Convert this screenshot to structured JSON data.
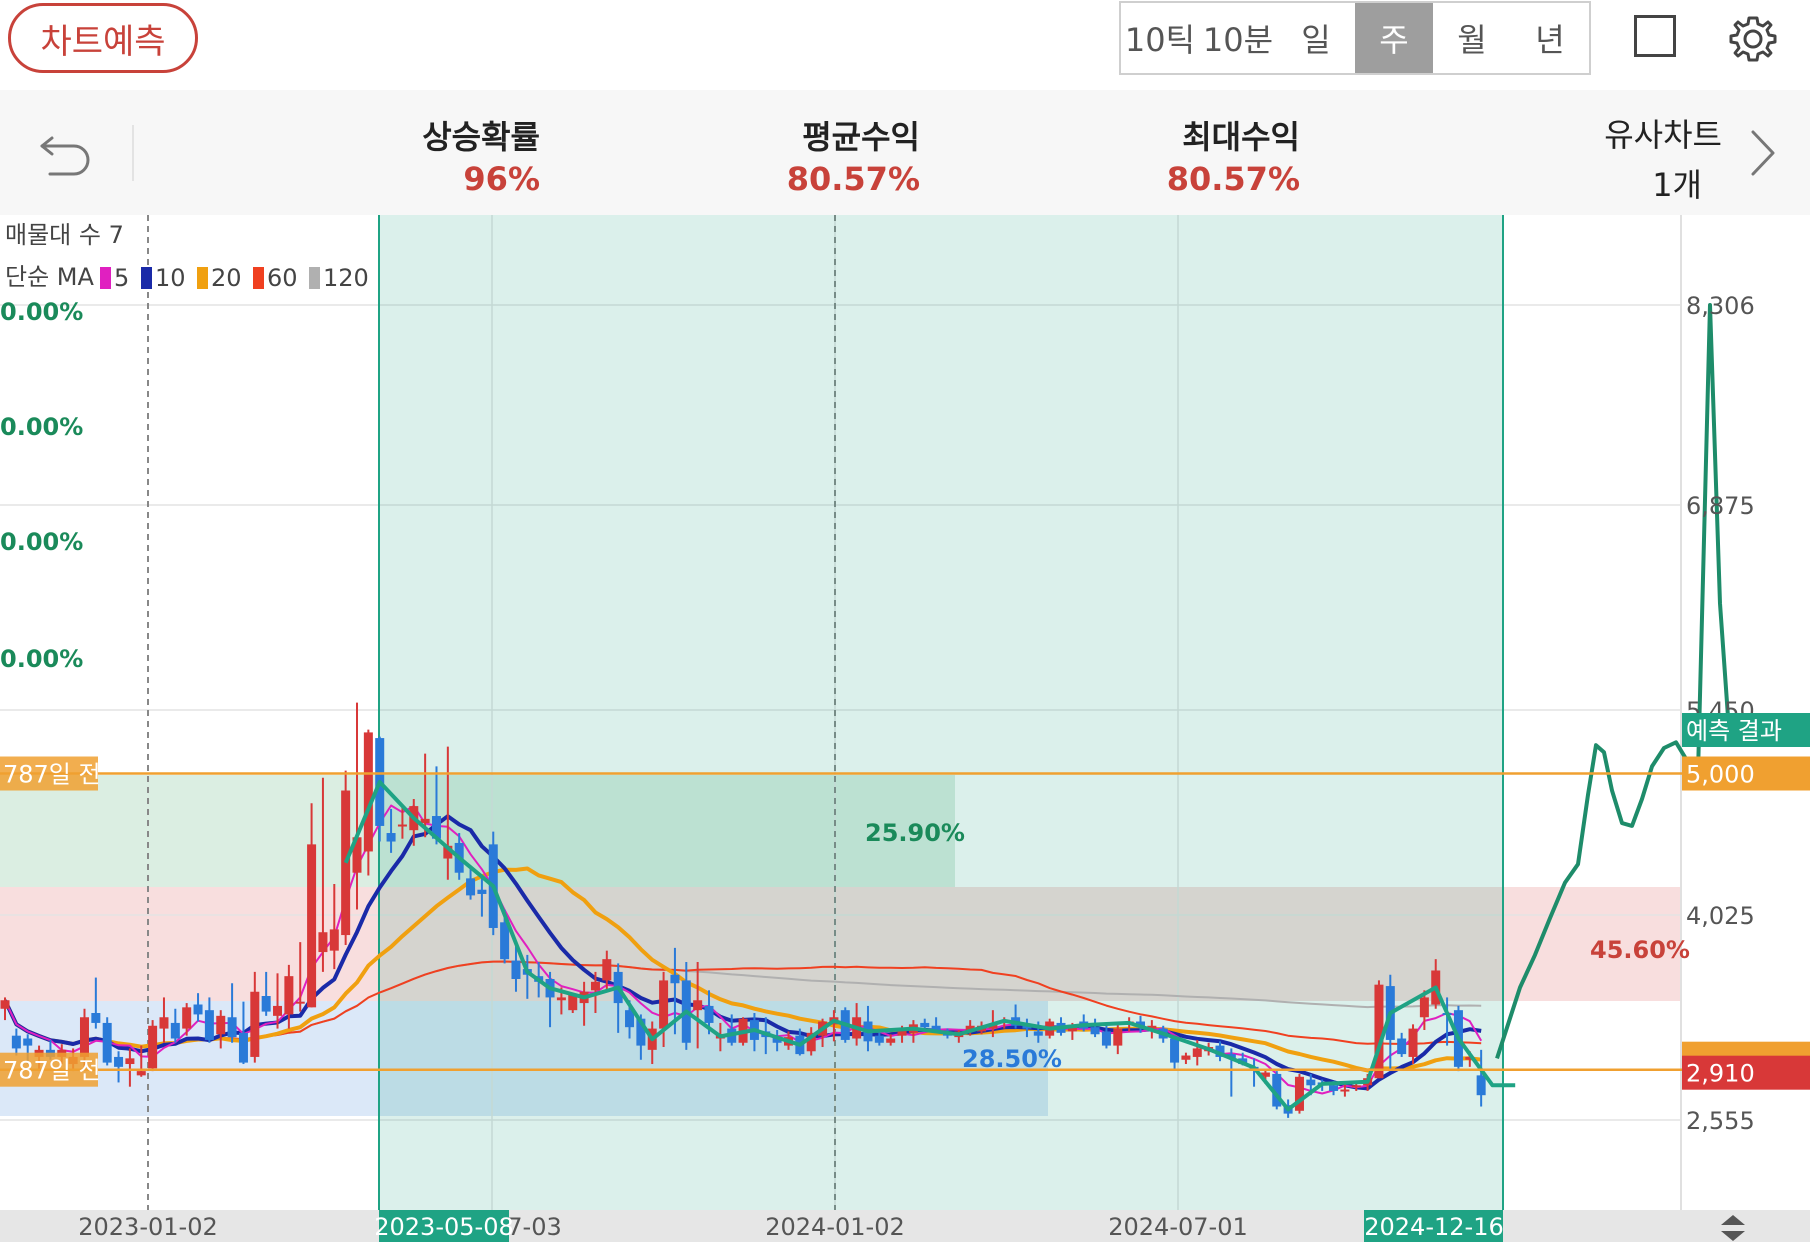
{
  "header": {
    "predict_button": "차트예측",
    "tabs": [
      {
        "label": "10틱",
        "active": false
      },
      {
        "label": "10분",
        "active": false
      },
      {
        "label": "일",
        "active": false
      },
      {
        "label": "주",
        "active": true
      },
      {
        "label": "월",
        "active": false
      },
      {
        "label": "년",
        "active": false
      }
    ]
  },
  "stats": {
    "rise_prob_label": "상승확률",
    "rise_prob_value": "96%",
    "avg_return_label": "평균수익",
    "avg_return_value": "80.57%",
    "max_return_label": "최대수익",
    "max_return_value": "80.57%",
    "similar_label": "유사차트",
    "similar_count": "1개"
  },
  "legend": {
    "volume_profile": "매물대 수 7",
    "ma_label": "단순 MA",
    "ma": [
      {
        "period": "5",
        "color": "#e020c0"
      },
      {
        "period": "10",
        "color": "#1a2aa8"
      },
      {
        "period": "20",
        "color": "#f0a010"
      },
      {
        "period": "60",
        "color": "#f04020"
      },
      {
        "period": "120",
        "color": "#b0b0b0"
      }
    ]
  },
  "colors": {
    "up": "#d83838",
    "down": "#2a7ad8",
    "similar_line": "#1fa384",
    "predict_line": "#1e8c6a",
    "highlight_green": "#1fa384",
    "level_line": "#f0a030",
    "pct_green": "#1a8a5a",
    "pct_red": "#c8423a",
    "pct_blue": "#2a7ad8"
  },
  "chart_data": {
    "type": "candlestick",
    "y_ticks": [
      "8,306",
      "6,875",
      "5,450",
      "4,025",
      "2,555"
    ],
    "x_ticks": [
      "2023-01-02",
      "2023-07-03",
      "2024-01-02",
      "2024-07-01"
    ],
    "highlight_start": "2023-05-08",
    "highlight_end": "2024-12-16",
    "left_pct_labels": [
      "0.00%",
      "0.00%",
      "0.00%",
      "0.00%"
    ],
    "levels": [
      {
        "label": "787일 전",
        "price_label": "5,000",
        "value": 5000
      },
      {
        "label": "787일 전",
        "price_label": "2,910",
        "value": 2910
      }
    ],
    "zones": [
      {
        "label": "25.90%",
        "color": "green"
      },
      {
        "label": "45.60%",
        "color": "red"
      },
      {
        "label": "28.50%",
        "color": "blue"
      }
    ],
    "prediction_label": "예측 결과",
    "candles": [
      [
        3340,
        3420,
        3260,
        3400
      ],
      [
        3150,
        3200,
        3010,
        3060
      ],
      [
        3130,
        3160,
        2950,
        3080
      ],
      [
        3000,
        3080,
        2900,
        3050
      ],
      [
        3050,
        3120,
        2980,
        3000
      ],
      [
        3000,
        3090,
        2950,
        3050
      ],
      [
        2950,
        3060,
        2900,
        3000
      ],
      [
        3000,
        3340,
        2900,
        3280
      ],
      [
        3310,
        3560,
        3200,
        3240
      ],
      [
        3240,
        3280,
        2940,
        2960
      ],
      [
        3000,
        3040,
        2820,
        2930
      ],
      [
        2950,
        3060,
        2790,
        2990
      ],
      [
        2870,
        3080,
        2860,
        2900
      ],
      [
        2920,
        3260,
        2900,
        3220
      ],
      [
        3200,
        3420,
        3100,
        3280
      ],
      [
        3240,
        3340,
        3100,
        3130
      ],
      [
        3200,
        3380,
        3150,
        3350
      ],
      [
        3370,
        3450,
        3250,
        3300
      ],
      [
        3330,
        3420,
        3100,
        3120
      ],
      [
        3160,
        3330,
        3060,
        3290
      ],
      [
        3280,
        3520,
        3100,
        3140
      ],
      [
        3170,
        3390,
        2950,
        2960
      ],
      [
        3000,
        3600,
        2960,
        3460
      ],
      [
        3430,
        3600,
        3290,
        3320
      ],
      [
        3290,
        3590,
        3200,
        3360
      ],
      [
        3300,
        3650,
        3200,
        3570
      ],
      [
        3380,
        3810,
        3320,
        3390
      ],
      [
        3350,
        4790,
        3350,
        4500
      ],
      [
        3740,
        4970,
        3600,
        3880
      ],
      [
        3750,
        4220,
        3620,
        3900
      ],
      [
        3860,
        5020,
        3790,
        4880
      ],
      [
        4300,
        5500,
        4040,
        4550
      ],
      [
        4450,
        5310,
        4280,
        5290
      ],
      [
        5250,
        5260,
        4520,
        4630
      ],
      [
        4580,
        4750,
        4440,
        4520
      ],
      [
        4630,
        4760,
        4540,
        4640
      ],
      [
        4600,
        4820,
        4490,
        4770
      ],
      [
        4650,
        5140,
        4550,
        4680
      ],
      [
        4700,
        5050,
        4500,
        4540
      ],
      [
        4400,
        5190,
        4250,
        4490
      ],
      [
        4510,
        4580,
        4250,
        4300
      ],
      [
        4260,
        4340,
        4110,
        4140
      ],
      [
        4180,
        4260,
        3990,
        4150
      ],
      [
        4500,
        4590,
        3860,
        3910
      ],
      [
        3950,
        4040,
        3660,
        3690
      ],
      [
        3680,
        3780,
        3460,
        3550
      ],
      [
        3620,
        3720,
        3410,
        3580
      ],
      [
        3570,
        3670,
        3420,
        3530
      ],
      [
        3550,
        3600,
        3210,
        3420
      ],
      [
        3400,
        3490,
        3300,
        3420
      ],
      [
        3330,
        3440,
        3310,
        3440
      ],
      [
        3380,
        3530,
        3220,
        3460
      ],
      [
        3470,
        3600,
        3310,
        3530
      ],
      [
        3540,
        3750,
        3470,
        3690
      ],
      [
        3600,
        3660,
        3170,
        3380
      ],
      [
        3330,
        3400,
        3130,
        3210
      ],
      [
        3270,
        3300,
        2980,
        3080
      ],
      [
        3050,
        3250,
        2950,
        3200
      ],
      [
        3200,
        3600,
        3070,
        3540
      ],
      [
        3580,
        3770,
        3160,
        3520
      ],
      [
        3540,
        3670,
        3050,
        3100
      ],
      [
        3330,
        3670,
        3060,
        3400
      ],
      [
        3360,
        3470,
        3160,
        3240
      ],
      [
        3130,
        3240,
        3040,
        3160
      ],
      [
        3200,
        3300,
        3080,
        3100
      ],
      [
        3100,
        3280,
        3080,
        3270
      ],
      [
        3260,
        3310,
        3040,
        3120
      ],
      [
        3180,
        3280,
        3020,
        3140
      ],
      [
        3140,
        3190,
        3040,
        3100
      ],
      [
        3080,
        3180,
        3050,
        3140
      ],
      [
        3150,
        3200,
        3010,
        3020
      ],
      [
        3040,
        3210,
        3010,
        3170
      ],
      [
        3150,
        3270,
        3070,
        3250
      ],
      [
        3230,
        3330,
        3110,
        3280
      ],
      [
        3330,
        3350,
        3100,
        3120
      ],
      [
        3130,
        3380,
        3080,
        3280
      ],
      [
        3250,
        3360,
        3040,
        3110
      ],
      [
        3150,
        3170,
        3080,
        3100
      ],
      [
        3100,
        3160,
        3080,
        3130
      ],
      [
        3150,
        3220,
        3100,
        3200
      ],
      [
        3170,
        3260,
        3100,
        3230
      ],
      [
        3240,
        3270,
        3200,
        3210
      ],
      [
        3220,
        3280,
        3170,
        3190
      ],
      [
        3170,
        3200,
        3130,
        3150
      ],
      [
        3140,
        3190,
        3100,
        3180
      ],
      [
        3180,
        3260,
        3150,
        3220
      ],
      [
        3180,
        3250,
        3160,
        3220
      ],
      [
        3200,
        3330,
        3140,
        3230
      ],
      [
        3250,
        3280,
        3200,
        3260
      ],
      [
        3280,
        3370,
        3200,
        3220
      ],
      [
        3220,
        3270,
        3140,
        3200
      ],
      [
        3180,
        3250,
        3100,
        3150
      ],
      [
        3150,
        3270,
        3130,
        3250
      ],
      [
        3240,
        3280,
        3150,
        3170
      ],
      [
        3180,
        3240,
        3120,
        3220
      ],
      [
        3250,
        3300,
        3180,
        3200
      ],
      [
        3210,
        3270,
        3140,
        3160
      ],
      [
        3180,
        3220,
        3060,
        3080
      ],
      [
        3080,
        3230,
        3020,
        3200
      ],
      [
        3230,
        3280,
        3180,
        3250
      ],
      [
        3250,
        3290,
        3170,
        3210
      ],
      [
        3200,
        3260,
        3130,
        3220
      ],
      [
        3200,
        3220,
        3100,
        3130
      ],
      [
        3130,
        3150,
        2910,
        2960
      ],
      [
        2980,
        3030,
        2950,
        3010
      ],
      [
        3000,
        3120,
        2940,
        3060
      ],
      [
        3040,
        3100,
        3010,
        3070
      ],
      [
        3080,
        3110,
        2970,
        3000
      ],
      [
        3020,
        3060,
        2720,
        2990
      ],
      [
        2990,
        3030,
        2940,
        2950
      ],
      [
        2930,
        2990,
        2790,
        2920
      ],
      [
        2860,
        2910,
        2810,
        2890
      ],
      [
        2880,
        2900,
        2630,
        2650
      ],
      [
        2660,
        2700,
        2570,
        2600
      ],
      [
        2620,
        2880,
        2600,
        2860
      ],
      [
        2840,
        2880,
        2730,
        2800
      ],
      [
        2820,
        2840,
        2760,
        2800
      ],
      [
        2800,
        2830,
        2730,
        2760
      ],
      [
        2760,
        2820,
        2720,
        2770
      ],
      [
        2790,
        2830,
        2760,
        2800
      ],
      [
        2800,
        2880,
        2760,
        2850
      ],
      [
        2850,
        3540,
        2850,
        3510
      ],
      [
        3500,
        3580,
        2900,
        3120
      ],
      [
        3130,
        3170,
        3000,
        3020
      ],
      [
        3000,
        3230,
        2950,
        3200
      ],
      [
        3280,
        3470,
        3190,
        3420
      ],
      [
        3370,
        3690,
        3340,
        3610
      ],
      [
        3310,
        3420,
        3080,
        3300
      ],
      [
        3330,
        3360,
        2900,
        2930
      ],
      [
        2980,
        3040,
        2930,
        3000
      ],
      [
        2870,
        3050,
        2650,
        2730
      ]
    ]
  }
}
